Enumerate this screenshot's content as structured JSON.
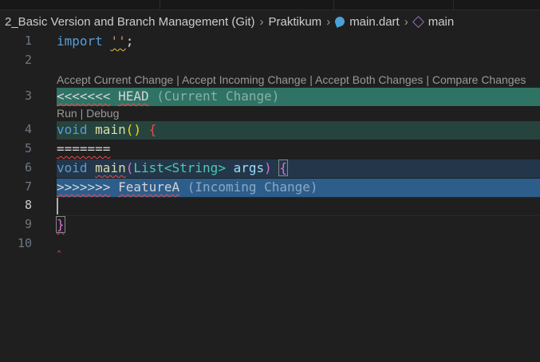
{
  "breadcrumb": {
    "folder": "2_Basic Version and Branch Management (Git)",
    "subfolder": "Praktikum",
    "file": "main.dart",
    "symbol": "main"
  },
  "codelens": {
    "merge": "Accept Current Change | Accept Incoming Change | Accept Both Changes | Compare Changes",
    "run": "Run | Debug"
  },
  "lines": {
    "n1": "1",
    "n2": "2",
    "n3": "3",
    "n4": "4",
    "n5": "5",
    "n6": "6",
    "n7": "7",
    "n8": "8",
    "n9": "9",
    "n10": "10"
  },
  "code": {
    "l1_kw": "import",
    "l1_str": "''",
    "l1_end": ";",
    "l3_marker": "<<<<<<<",
    "l3_head": "HEAD",
    "l3_label": "(Current Change)",
    "l4_void": "void",
    "l4_main": "main",
    "l4_paren": "()",
    "l4_brace": "{",
    "l5": "=======",
    "l6_void": "void",
    "l6_main": "main",
    "l6_po": "(",
    "l6_list": "List",
    "l6_lt": "<",
    "l6_str": "String",
    "l6_gt": ">",
    "l6_args": "args",
    "l6_pc": ")",
    "l6_brace": "{",
    "l7_marker": ">>>>>>>",
    "l7_branch": "FeatureA",
    "l7_label": "(Incoming Change)",
    "l9": "}"
  },
  "colors": {
    "current": "#2f7365",
    "current_body": "#26443d",
    "incoming_body": "#24374a",
    "incoming": "#2d5d8b"
  }
}
